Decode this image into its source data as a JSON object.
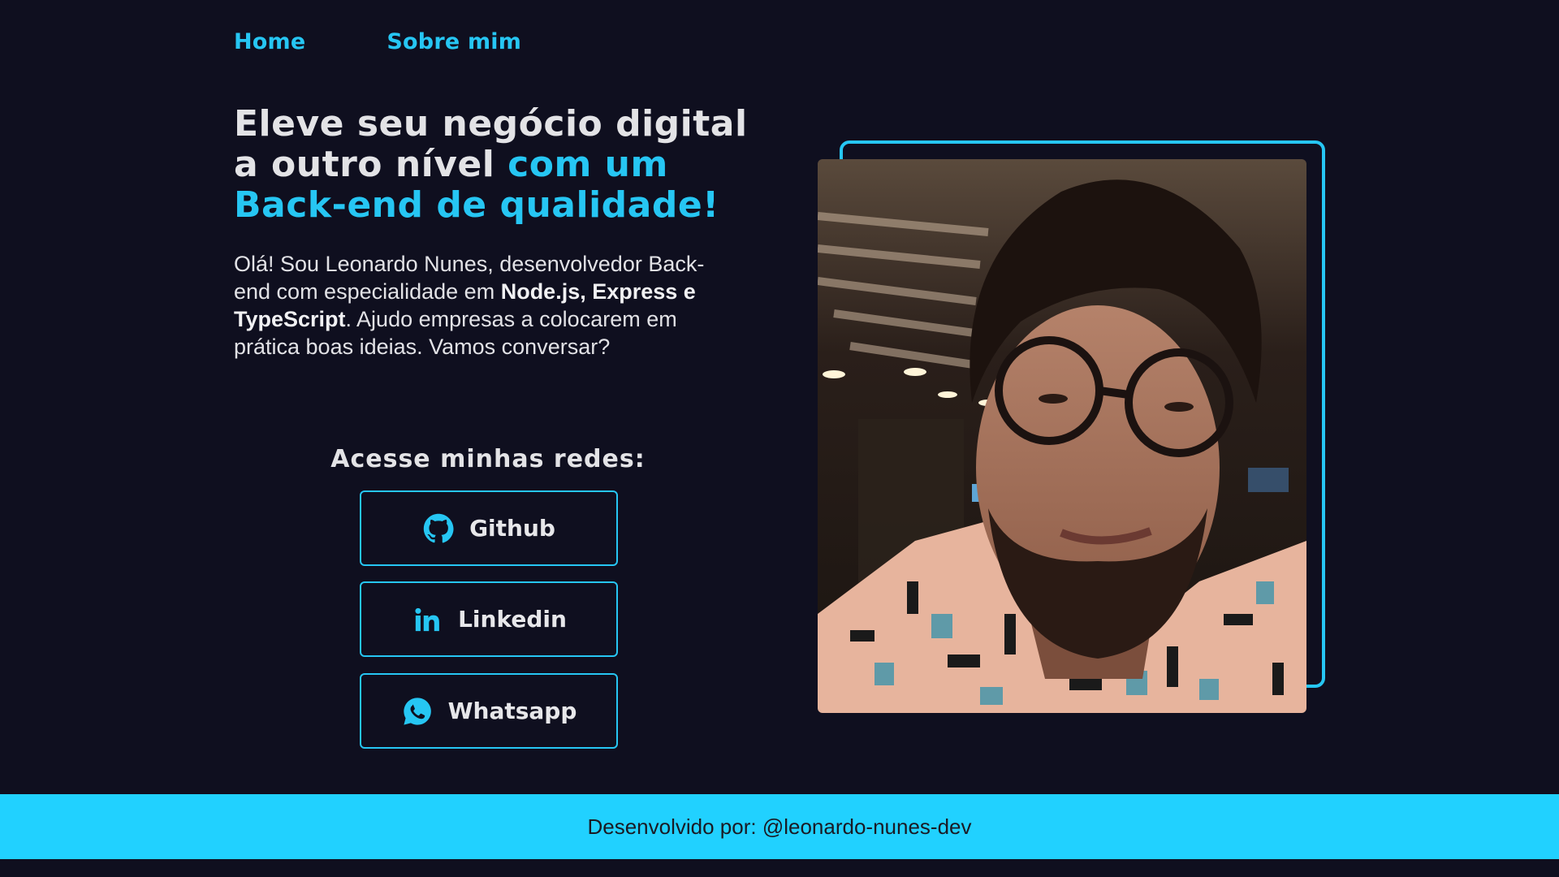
{
  "nav": {
    "home": "Home",
    "about": "Sobre mim"
  },
  "hero": {
    "headline_plain": "Eleve seu negócio digital a outro nível ",
    "headline_accent": "com um Back-end de qualidade!",
    "intro_1": "Olá! Sou Leonardo Nunes, desenvolvedor Back-end com especialidade em ",
    "intro_bold": "Node.js, Express e TypeScript",
    "intro_2": ". Ajudo empresas a colocarem em prática boas ideias. Vamos conversar?"
  },
  "socials": {
    "title": "Acesse minhas redes:",
    "github": "Github",
    "linkedin": "Linkedin",
    "whatsapp": "Whatsapp"
  },
  "footer": {
    "credit": "Desenvolvido por: @leonardo-nunes-dev"
  },
  "colors": {
    "background": "#0f0f1f",
    "accent": "#26c6f3",
    "footer": "#21d1ff"
  },
  "icons": {
    "github": "github-icon",
    "linkedin": "linkedin-icon",
    "whatsapp": "whatsapp-icon"
  }
}
